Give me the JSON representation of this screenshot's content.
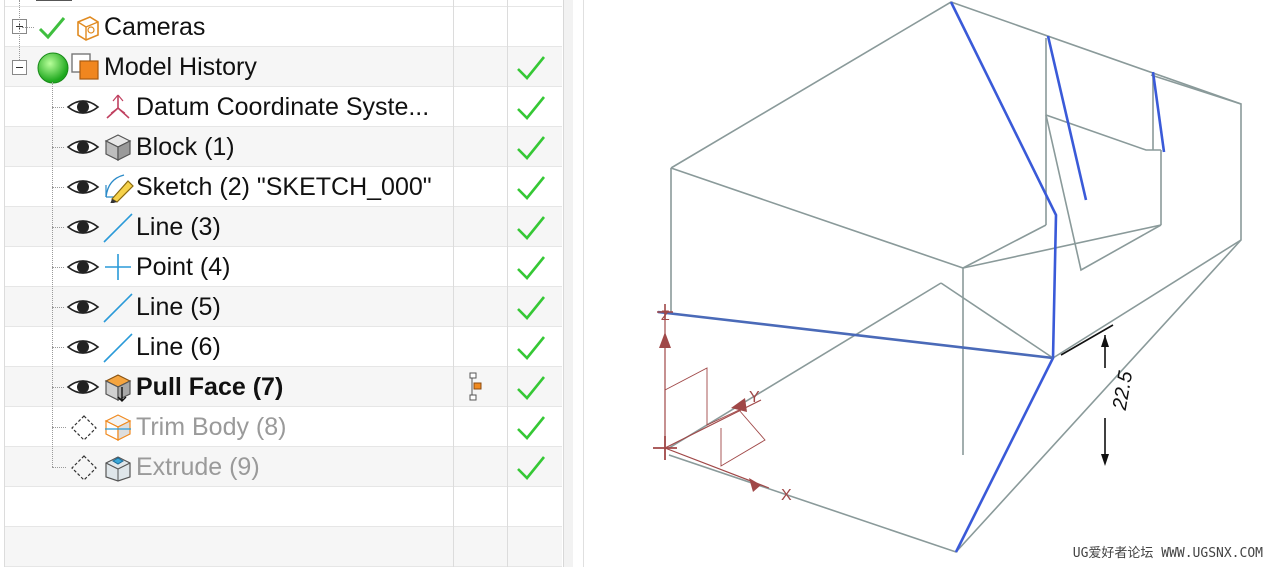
{
  "navigator": {
    "rows": [
      {
        "label": "Cameras"
      },
      {
        "label": "Model History"
      },
      {
        "label": "Datum Coordinate Syste..."
      },
      {
        "label": "Block (1)"
      },
      {
        "label": "Sketch (2) \"SKETCH_000\""
      },
      {
        "label": "Line (3)"
      },
      {
        "label": "Point (4)"
      },
      {
        "label": "Line (5)"
      },
      {
        "label": "Line (6)"
      },
      {
        "label": "Pull Face (7)"
      },
      {
        "label": "Trim Body (8)"
      },
      {
        "label": "Extrude (9)"
      }
    ]
  },
  "viewport": {
    "dimension_value": "22.5",
    "axes": {
      "x": "X",
      "y": "Y",
      "z": "Z"
    },
    "colors": {
      "edge": "#8a9a9a",
      "selected": "#3a5ad8",
      "csys": "#a04848"
    }
  },
  "watermark": "UG爱好者论坛 WWW.UGSNX.COM"
}
